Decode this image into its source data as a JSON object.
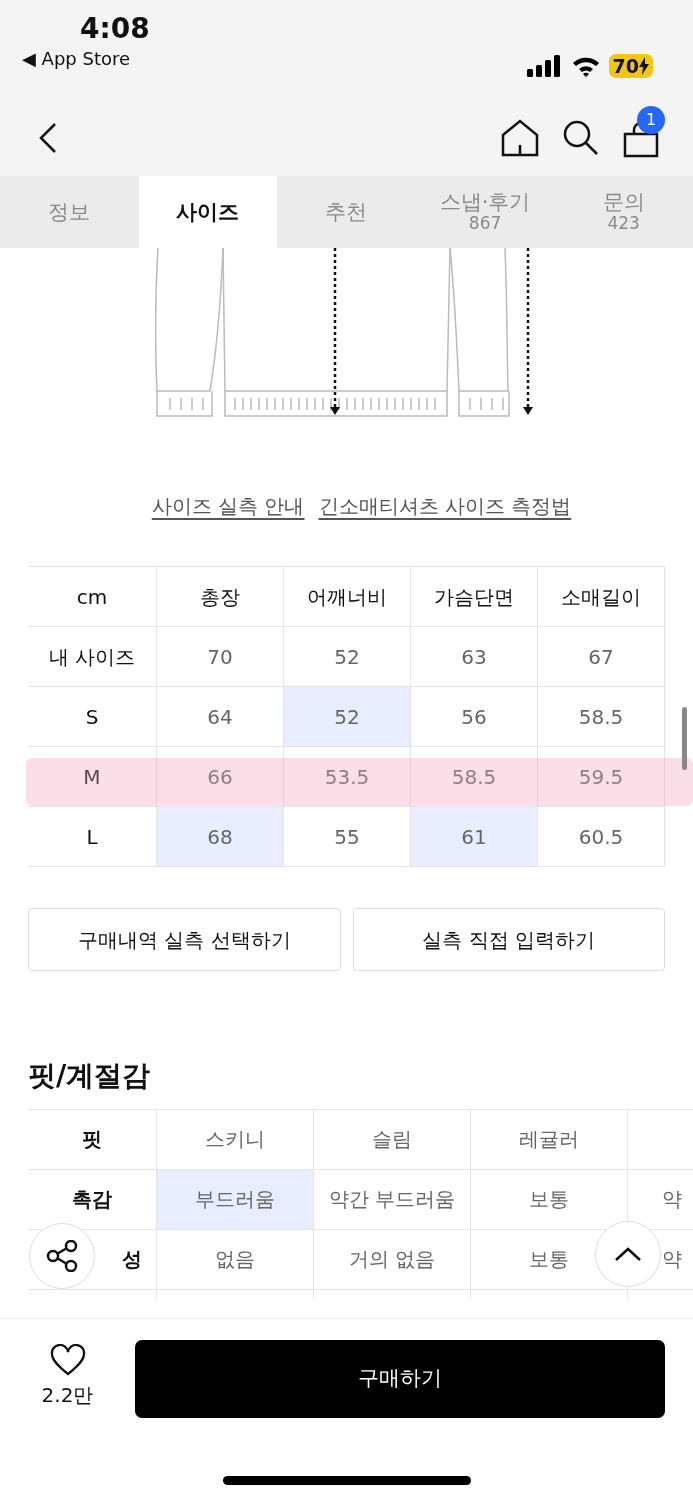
{
  "status_bar": {
    "time": "4:08",
    "back_app": "◀ App Store",
    "battery": "70"
  },
  "nav": {
    "cart_count": "1"
  },
  "tabs": [
    {
      "label": "정보",
      "selected": false
    },
    {
      "label": "사이즈",
      "selected": true
    },
    {
      "label": "추천",
      "selected": false
    },
    {
      "label": "스냅·후기",
      "count": "867",
      "selected": false
    },
    {
      "label": "문의",
      "count": "423",
      "selected": false
    }
  ],
  "links": [
    "사이즈 실측 안내",
    "긴소매티셔츠 사이즈 측정법"
  ],
  "size_table": {
    "corner_label": "cm",
    "columns": [
      "총장",
      "어깨너비",
      "가슴단면",
      "소매길이"
    ],
    "rows": [
      {
        "label": "내 사이즈",
        "marked": false,
        "cells": [
          {
            "text": "70",
            "highlighted": false
          },
          {
            "text": "52",
            "highlighted": false
          },
          {
            "text": "63",
            "highlighted": false
          },
          {
            "text": "67",
            "highlighted": false
          }
        ]
      },
      {
        "label": "S",
        "marked": false,
        "cells": [
          {
            "text": "64",
            "highlighted": false
          },
          {
            "text": "52",
            "highlighted": true
          },
          {
            "text": "56",
            "highlighted": false
          },
          {
            "text": "58.5",
            "highlighted": false
          }
        ]
      },
      {
        "label": "M",
        "marked": true,
        "cells": [
          {
            "text": "66",
            "highlighted": false
          },
          {
            "text": "53.5",
            "highlighted": false
          },
          {
            "text": "58.5",
            "highlighted": false
          },
          {
            "text": "59.5",
            "highlighted": false
          }
        ]
      },
      {
        "label": "L",
        "marked": false,
        "cells": [
          {
            "text": "68",
            "highlighted": true
          },
          {
            "text": "55",
            "highlighted": false
          },
          {
            "text": "61",
            "highlighted": true
          },
          {
            "text": "60.5",
            "highlighted": false
          }
        ]
      }
    ]
  },
  "buttons": [
    "구매내역 실측 선택하기",
    "실측 직접 입력하기"
  ],
  "fit_section": {
    "title": "핏/계절감",
    "rows": [
      {
        "label": "핏",
        "cells": [
          {
            "text": "스키니",
            "highlighted": false
          },
          {
            "text": "슬림",
            "highlighted": false
          },
          {
            "text": "레귤러",
            "highlighted": false
          }
        ]
      },
      {
        "label": "촉감",
        "cells": [
          {
            "text": "부드러움",
            "highlighted": true
          },
          {
            "text": "약간 부드러움",
            "highlighted": false
          },
          {
            "text": "보통",
            "highlighted": false
          },
          {
            "text": "약",
            "highlighted": false
          }
        ]
      },
      {
        "label": "성",
        "cells": [
          {
            "text": "없음",
            "highlighted": false
          },
          {
            "text": "거의 없음",
            "highlighted": false
          },
          {
            "text": "보통",
            "highlighted": false
          },
          {
            "text": "약",
            "highlighted": false
          }
        ]
      }
    ]
  },
  "bottom_bar": {
    "likes": "2.2만",
    "buy_button": "구매하기"
  }
}
